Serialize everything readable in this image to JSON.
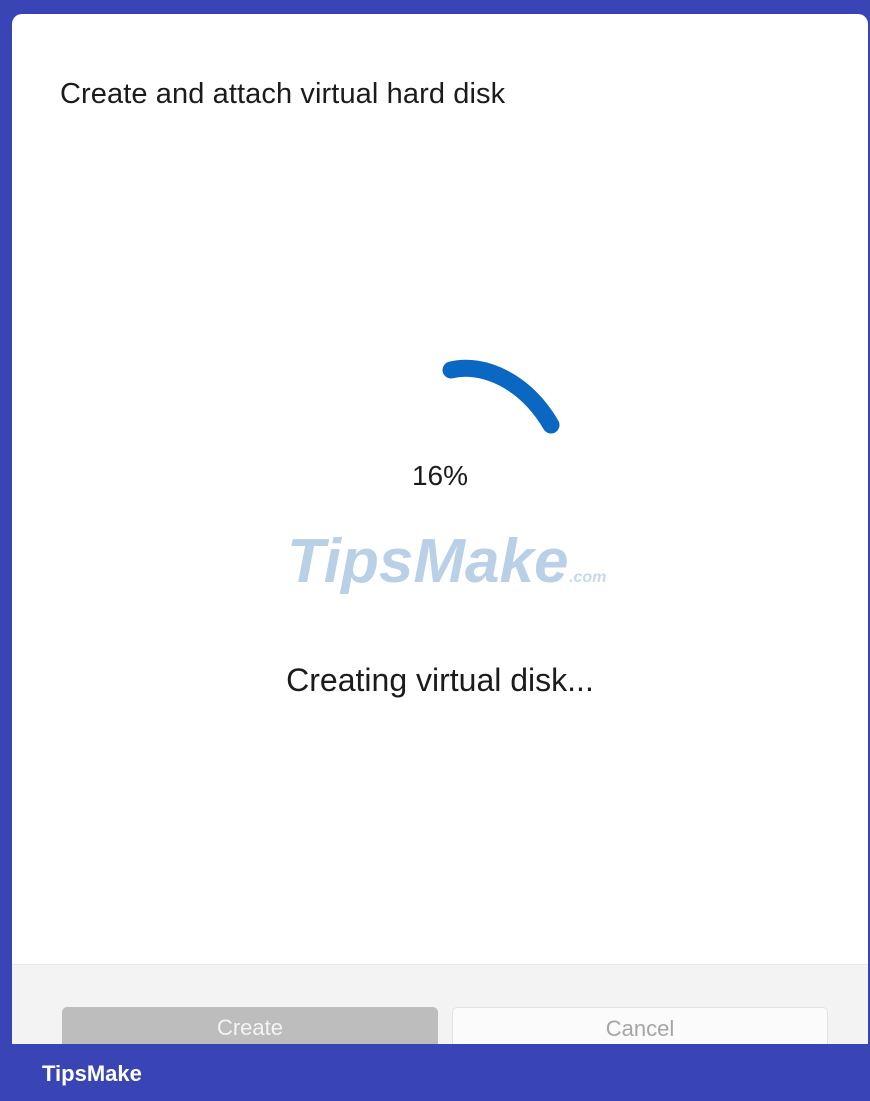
{
  "dialog": {
    "title": "Create and attach virtual hard disk",
    "progress_percent_label": "16%",
    "progress_value": 16,
    "status_text": "Creating virtual disk...",
    "buttons": {
      "create_label": "Create",
      "cancel_label": "Cancel"
    }
  },
  "watermark": {
    "brand": "TipsMake",
    "suffix": ".com"
  },
  "brand_bar": {
    "label": "TipsMake"
  },
  "colors": {
    "accent": "#0a67c2",
    "brand_bar": "#3a45b5",
    "disabled_button": "#bdbdbd"
  },
  "icons": {
    "spinner": "progress-ring-icon"
  }
}
